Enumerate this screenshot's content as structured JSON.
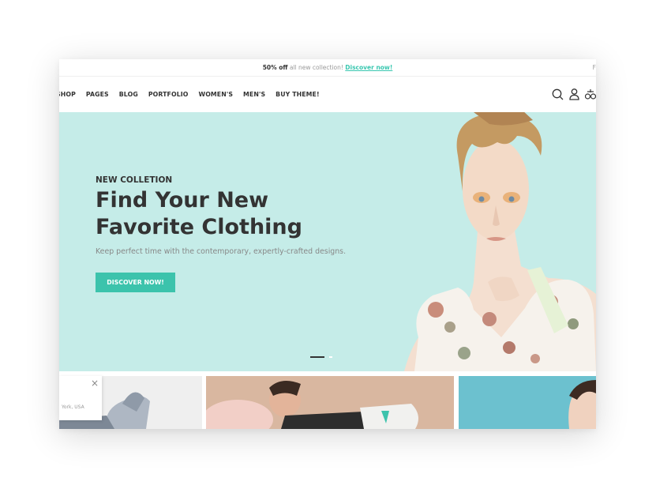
{
  "announcement": {
    "bold": "50% off",
    "text": " all new collection! ",
    "link": "Discover now!",
    "edge": "F"
  },
  "nav": {
    "items": [
      "SHOP",
      "PAGES",
      "BLOG",
      "PORTFOLIO",
      "WOMEN'S",
      "MEN'S",
      "BUY THEME!"
    ],
    "icons": [
      "search-icon",
      "user-icon",
      "compare-icon"
    ]
  },
  "hero": {
    "eyebrow": "NEW COLLETION",
    "title": "Find Your New Favorite Clothing",
    "subtitle": "Keep perfect time with the contemporary, expertly-crafted designs.",
    "cta": "DISCOVER NOW!",
    "slides": 2,
    "active_slide": 1
  },
  "popup": {
    "close": "×",
    "location": "York, USA"
  },
  "colors": {
    "accent": "#3cc3ac",
    "hero_bg": "#c5ece8",
    "text": "#333333"
  }
}
